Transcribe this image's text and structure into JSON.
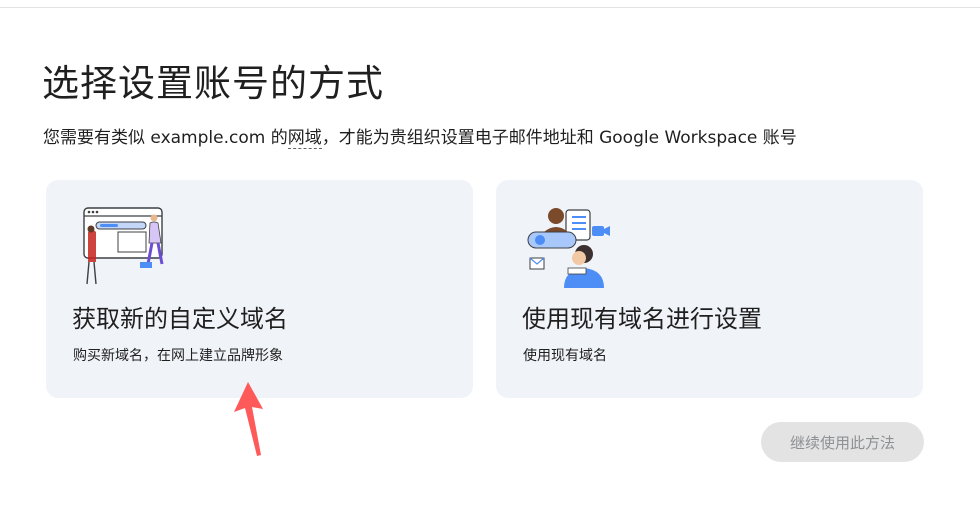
{
  "page": {
    "title": "选择设置账号的方式",
    "subtitle_prefix": "您需要有类似 example.com 的",
    "subtitle_term": "网域",
    "subtitle_suffix": "，才能为贵组织设置电子邮件地址和 Google Workspace 账号"
  },
  "options": [
    {
      "title": "获取新的自定义域名",
      "description": "购买新域名，在网上建立品牌形象",
      "illustration": "browser-domain-illustration"
    },
    {
      "title": "使用现有域名进行设置",
      "description": "使用现有域名",
      "illustration": "people-communication-illustration"
    }
  ],
  "actions": {
    "continue_label": "继续使用此方法",
    "continue_enabled": false
  },
  "annotation": {
    "arrow_color": "#ff5a5a"
  },
  "colors": {
    "card_bg": "#f0f3f8",
    "accent_blue": "#4c8df6",
    "button_disabled_bg": "#e3e3e3",
    "button_disabled_text": "#8e9194"
  }
}
